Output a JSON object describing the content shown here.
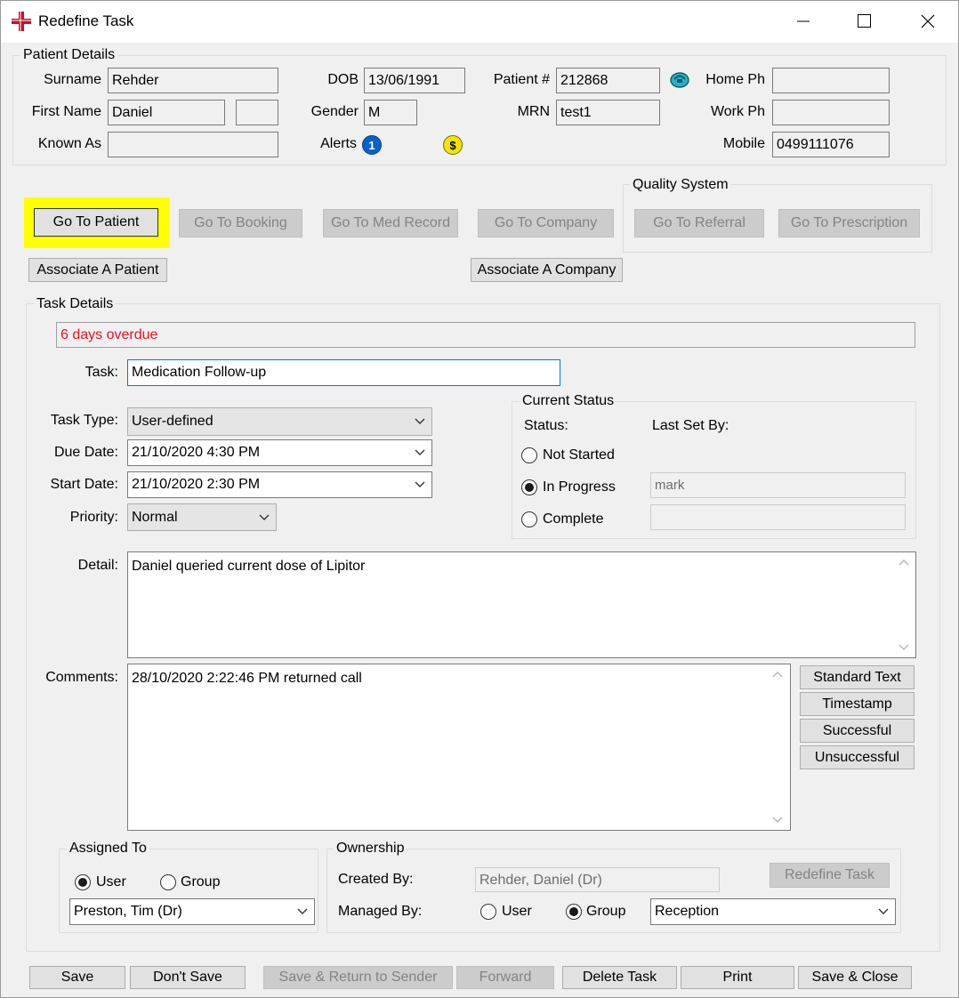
{
  "window": {
    "title": "Redefine Task",
    "controls": {
      "minimize": "minimize-icon",
      "maximize": "maximize-icon",
      "close": "close-icon"
    }
  },
  "patient_details": {
    "legend": "Patient Details",
    "surname_label": "Surname",
    "surname": "Rehder",
    "first_name_label": "First Name",
    "first_name": "Daniel",
    "middle": "",
    "known_as_label": "Known As",
    "known_as": "",
    "dob_label": "DOB",
    "dob": "13/06/1991",
    "gender_label": "Gender",
    "gender": "M",
    "alerts_label": "Alerts",
    "alert_badge": "1",
    "alert_dollar": "$",
    "patient_no_label": "Patient #",
    "patient_no": "212868",
    "mrn_label": "MRN",
    "mrn": "test1",
    "home_ph_label": "Home Ph",
    "home_ph": "",
    "work_ph_label": "Work Ph",
    "work_ph": "",
    "mobile_label": "Mobile",
    "mobile": "0499111076"
  },
  "nav_buttons": {
    "go_to_patient": "Go To Patient",
    "go_to_booking": "Go To Booking",
    "go_to_med_record": "Go To Med Record",
    "go_to_company": "Go To Company",
    "associate_patient": "Associate A Patient",
    "associate_company": "Associate A Company"
  },
  "quality_system": {
    "legend": "Quality System",
    "go_to_referral": "Go To Referral",
    "go_to_prescription": "Go To Prescription"
  },
  "task_details": {
    "legend": "Task Details",
    "overdue": "6 days overdue",
    "task_label": "Task:",
    "task": "Medication Follow-up",
    "task_type_label": "Task Type:",
    "task_type": "User-defined",
    "due_date_label": "Due Date:",
    "due_date": "21/10/2020  4:30 PM",
    "start_date_label": "Start Date:",
    "start_date": "21/10/2020  2:30 PM",
    "priority_label": "Priority:",
    "priority": "Normal",
    "detail_label": "Detail:",
    "detail": "Daniel queried current dose of Lipitor",
    "comments_label": "Comments:",
    "comments": "28/10/2020 2:22:46 PM returned call"
  },
  "current_status": {
    "legend": "Current Status",
    "status_label": "Status:",
    "last_set_by_label": "Last Set By:",
    "not_started": "Not Started",
    "in_progress": "In Progress",
    "complete": "Complete",
    "selected": "In Progress",
    "in_progress_by": "mark",
    "complete_by": ""
  },
  "comment_buttons": {
    "standard_text": "Standard Text",
    "timestamp": "Timestamp",
    "successful": "Successful",
    "unsuccessful": "Unsuccessful"
  },
  "assigned_to": {
    "legend": "Assigned To",
    "user": "User",
    "group": "Group",
    "selected": "User",
    "value": "Preston, Tim (Dr)"
  },
  "ownership": {
    "legend": "Ownership",
    "created_by_label": "Created By:",
    "created_by": "Rehder, Daniel (Dr)",
    "managed_by_label": "Managed By:",
    "user": "User",
    "group": "Group",
    "selected": "Group",
    "group_value": "Reception",
    "redefine_task": "Redefine Task"
  },
  "footer": {
    "save": "Save",
    "dont_save": "Don't Save",
    "save_return": "Save & Return to Sender",
    "forward": "Forward",
    "delete_task": "Delete Task",
    "print": "Print",
    "save_close": "Save & Close"
  },
  "colors": {
    "overdue_text": "#e81123",
    "highlight": "#ffff00",
    "focus_border": "#0078d7",
    "alert_blue": "#0a62c9",
    "alert_yellow": "#f5e400"
  }
}
